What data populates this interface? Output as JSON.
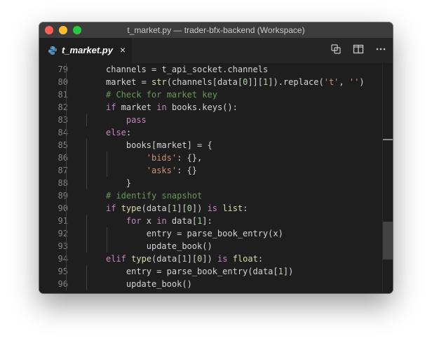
{
  "window": {
    "title": "t_market.py — trader-bfx-backend (Workspace)"
  },
  "tab": {
    "label": "t_market.py",
    "close": "×"
  },
  "icons": {
    "file": "python-icon",
    "compare": "open-changes-icon",
    "split": "split-editor-icon",
    "more": "more-actions-icon"
  },
  "colors": {
    "keyword": "#c586c0",
    "function": "#dcdcaa",
    "number": "#b5cea8",
    "string": "#ce9178",
    "comment": "#6a9955",
    "editor_bg": "#1e1e1e"
  },
  "editor": {
    "lines": [
      {
        "n": "79",
        "indent": 1,
        "tokens": [
          [
            "plain",
            "channels = t_api_socket.channels"
          ]
        ]
      },
      {
        "n": "80",
        "indent": 1,
        "tokens": [
          [
            "plain",
            "market = "
          ],
          [
            "fn",
            "str"
          ],
          [
            "plain",
            "(channels[data["
          ],
          [
            "num",
            "0"
          ],
          [
            "plain",
            "]]["
          ],
          [
            "num",
            "1"
          ],
          [
            "plain",
            "]).replace("
          ],
          [
            "str",
            "'t'"
          ],
          [
            "plain",
            ", "
          ],
          [
            "str",
            "''"
          ],
          [
            "plain",
            ")"
          ]
        ]
      },
      {
        "n": "81",
        "indent": 1,
        "tokens": [
          [
            "cm",
            "# Check for market key"
          ]
        ]
      },
      {
        "n": "82",
        "indent": 1,
        "tokens": [
          [
            "kw",
            "if"
          ],
          [
            "plain",
            " market "
          ],
          [
            "kw",
            "in"
          ],
          [
            "plain",
            " books.keys():"
          ]
        ]
      },
      {
        "n": "83",
        "indent": 2,
        "tokens": [
          [
            "kw",
            "pass"
          ]
        ]
      },
      {
        "n": "84",
        "indent": 1,
        "tokens": [
          [
            "kw",
            "else"
          ],
          [
            "plain",
            ":"
          ]
        ]
      },
      {
        "n": "85",
        "indent": 2,
        "tokens": [
          [
            "plain",
            "books[market] = {"
          ]
        ]
      },
      {
        "n": "86",
        "indent": 3,
        "tokens": [
          [
            "str",
            "'bids'"
          ],
          [
            "plain",
            ": {},"
          ]
        ]
      },
      {
        "n": "87",
        "indent": 3,
        "tokens": [
          [
            "str",
            "'asks'"
          ],
          [
            "plain",
            ": {}"
          ]
        ]
      },
      {
        "n": "88",
        "indent": 2,
        "tokens": [
          [
            "plain",
            "}"
          ]
        ]
      },
      {
        "n": "89",
        "indent": 1,
        "tokens": [
          [
            "cm",
            "# identify snapshot"
          ]
        ]
      },
      {
        "n": "90",
        "indent": 1,
        "tokens": [
          [
            "kw",
            "if"
          ],
          [
            "plain",
            " "
          ],
          [
            "fn",
            "type"
          ],
          [
            "plain",
            "(data["
          ],
          [
            "num",
            "1"
          ],
          [
            "plain",
            "]["
          ],
          [
            "num",
            "0"
          ],
          [
            "plain",
            "]) "
          ],
          [
            "kw",
            "is"
          ],
          [
            "plain",
            " "
          ],
          [
            "fn",
            "list"
          ],
          [
            "plain",
            ":"
          ]
        ]
      },
      {
        "n": "91",
        "indent": 2,
        "tokens": [
          [
            "kw",
            "for"
          ],
          [
            "plain",
            " x "
          ],
          [
            "kw",
            "in"
          ],
          [
            "plain",
            " data["
          ],
          [
            "num",
            "1"
          ],
          [
            "plain",
            "]:"
          ]
        ]
      },
      {
        "n": "92",
        "indent": 3,
        "tokens": [
          [
            "plain",
            "entry = parse_book_entry(x)"
          ]
        ]
      },
      {
        "n": "93",
        "indent": 3,
        "tokens": [
          [
            "plain",
            "update_book()"
          ]
        ]
      },
      {
        "n": "94",
        "indent": 1,
        "tokens": [
          [
            "kw",
            "elif"
          ],
          [
            "plain",
            " "
          ],
          [
            "fn",
            "type"
          ],
          [
            "plain",
            "(data["
          ],
          [
            "num",
            "1"
          ],
          [
            "plain",
            "]["
          ],
          [
            "num",
            "0"
          ],
          [
            "plain",
            "]) "
          ],
          [
            "kw",
            "is"
          ],
          [
            "plain",
            " "
          ],
          [
            "fn",
            "float"
          ],
          [
            "plain",
            ":"
          ]
        ]
      },
      {
        "n": "95",
        "indent": 2,
        "tokens": [
          [
            "plain",
            "entry = parse_book_entry(data["
          ],
          [
            "num",
            "1"
          ],
          [
            "plain",
            "])"
          ]
        ]
      },
      {
        "n": "96",
        "indent": 2,
        "tokens": [
          [
            "plain",
            "update_book()"
          ]
        ]
      }
    ]
  }
}
